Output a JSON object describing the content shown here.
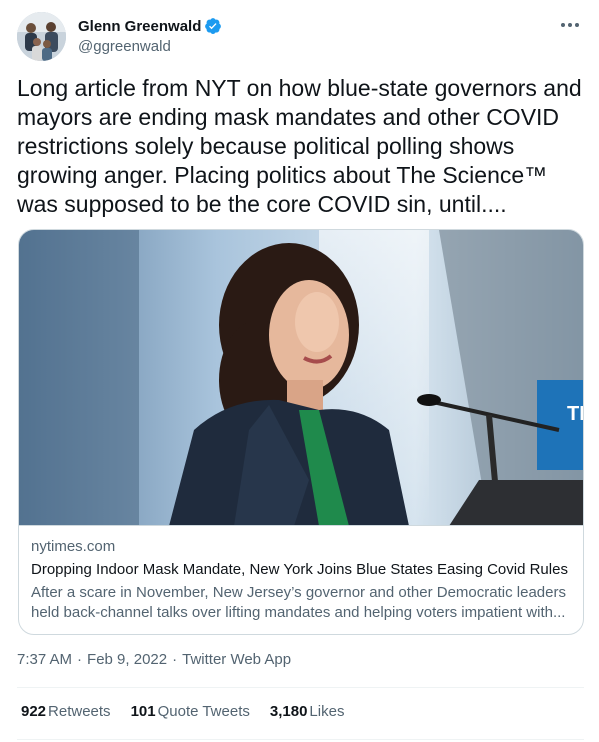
{
  "author": {
    "display_name": "Glenn Greenwald",
    "handle": "@ggreenwald",
    "verified_icon": "verified-badge-icon",
    "more_icon": "more-icon"
  },
  "tweet": {
    "text": "Long article from NYT on how blue-state governors and mayors are ending mask mandates and other COVID restrictions solely because political polling shows growing anger. Placing politics about The Science™ was supposed to be the core COVID sin, until...."
  },
  "card": {
    "domain": "nytimes.com",
    "title": "Dropping Indoor Mask Mandate, New York Joins Blue States Easing Covid Rules",
    "description": "After a scare in November, New Jersey’s governor and other Democratic leaders held back-channel talks over lifting mandates and helping voters impatient with...",
    "sign_text": "TE"
  },
  "meta": {
    "time": "7:37 AM",
    "date": "Feb 9, 2022",
    "source": "Twitter Web App",
    "separator": "·"
  },
  "stats": [
    {
      "count": "922",
      "label": "Retweets"
    },
    {
      "count": "101",
      "label": "Quote Tweets"
    },
    {
      "count": "3,180",
      "label": "Likes"
    }
  ],
  "colors": {
    "text": "#0f1419",
    "secondary": "#536471",
    "verified": "#1d9bf0",
    "border": "#cfd9de"
  }
}
